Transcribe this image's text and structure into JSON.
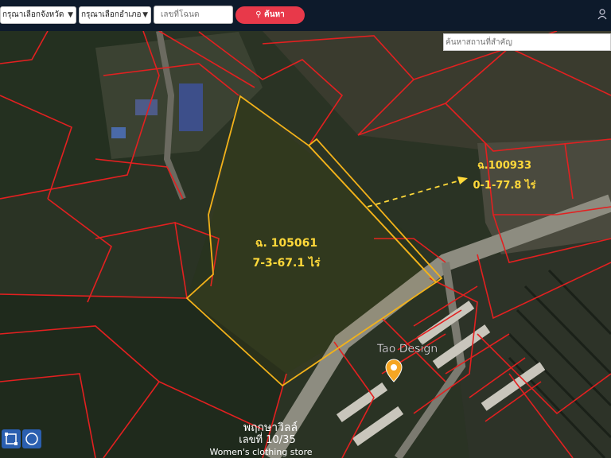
{
  "header": {
    "province_select": "กรุณาเลือกจังหวัด",
    "district_select": "กรุณาเลือกอำเภอ",
    "deed_number_placeholder": "เลขที่โฉนด",
    "search_button": "ค้นหา"
  },
  "map": {
    "place_search_placeholder": "ค้นหาสถานที่สำคัญ",
    "parcels": [
      {
        "deed": "ฉ. 105061",
        "area": "7-3-67.1 ไร่"
      },
      {
        "deed": "ฉ.100933",
        "area": "0-1-77.8 ไร่"
      }
    ],
    "pois": [
      {
        "name": "Tao Design"
      },
      {
        "name": "พฤกษาวิลล์",
        "line2": "เลขที่ 10/35",
        "line3": "Women's clothing store"
      }
    ],
    "colors": {
      "boundary": "#e32020",
      "highlight": "#f2b21a",
      "label": "#ffd93a",
      "poi_marker": "#f5a623"
    }
  },
  "tools": [
    {
      "icon": "rectangle-draw-icon"
    },
    {
      "icon": "circle-draw-icon"
    }
  ]
}
